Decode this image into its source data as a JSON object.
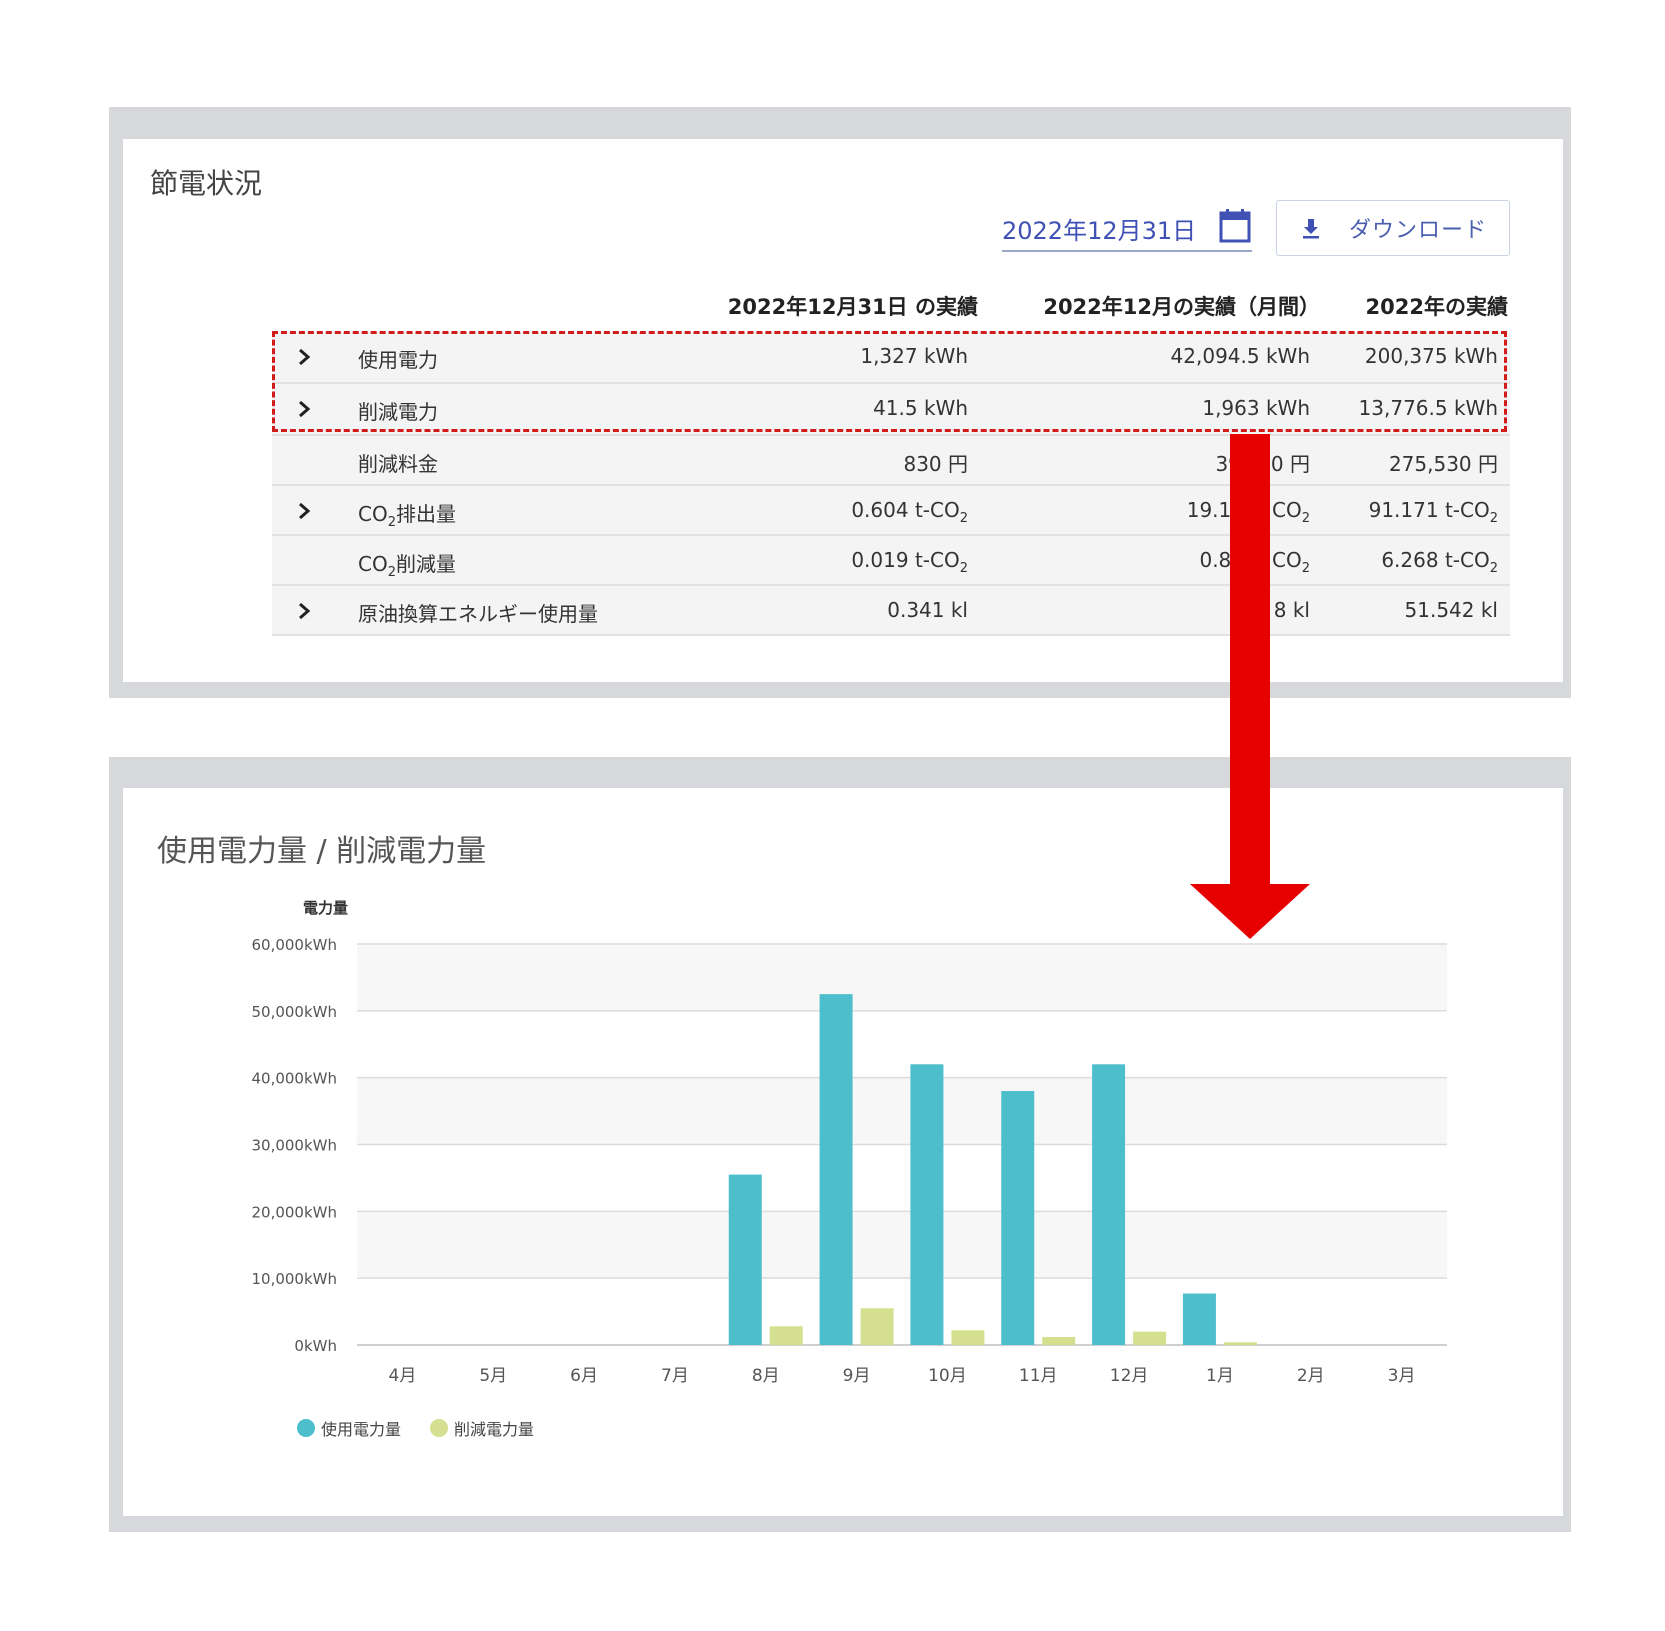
{
  "summary": {
    "title": "節電状況",
    "date_value": "2022年12月31日",
    "download_label": "ダウンロード",
    "columns": [
      "2022年12月31日 の実績",
      "2022年12月の実績（月間）",
      "2022年の実績"
    ],
    "rows": [
      {
        "expandable": true,
        "label": "使用電力",
        "day": "1,327 kWh",
        "month": "42,094.5 kWh",
        "year": "200,375 kWh"
      },
      {
        "expandable": true,
        "label": "削減電力",
        "day": "41.5 kWh",
        "month": "1,963 kWh",
        "year": "13,776.5 kWh"
      },
      {
        "expandable": false,
        "label": "削減料金",
        "day": "830 円",
        "month": "39",
        "month_tail": "0 円",
        "year": "275,530 円"
      },
      {
        "expandable": true,
        "label_pre": "CO",
        "label_sub": "2",
        "label_post": "排出量",
        "day": "0.604 t-CO",
        "day_sub": "2",
        "month": "19.15",
        "month_tail": "CO",
        "month_sub": "2",
        "year": "91.171 t-CO",
        "year_sub": "2"
      },
      {
        "expandable": false,
        "label_pre": "CO",
        "label_sub": "2",
        "label_post": "削減量",
        "day": "0.019 t-CO",
        "day_sub": "2",
        "month": "0.89",
        "month_tail": "CO",
        "month_sub": "2",
        "year": "6.268 t-CO",
        "year_sub": "2"
      },
      {
        "expandable": true,
        "label": "原油換算エネルギー使用量",
        "day": "0.341 kl",
        "month": "1",
        "month_tail": "8 kl",
        "year": "51.542 kl"
      }
    ]
  },
  "chart_panel": {
    "title": "使用電力量 / 削減電力量"
  },
  "chart_data": {
    "type": "bar",
    "ylabel": "電力量",
    "ylim": [
      0,
      60000
    ],
    "y_ticks": [
      "0kWh",
      "10,000kWh",
      "20,000kWh",
      "30,000kWh",
      "40,000kWh",
      "50,000kWh",
      "60,000kWh"
    ],
    "y_tick_values": [
      0,
      10000,
      20000,
      30000,
      40000,
      50000,
      60000
    ],
    "categories": [
      "4月",
      "5月",
      "6月",
      "7月",
      "8月",
      "9月",
      "10月",
      "11月",
      "12月",
      "1月",
      "2月",
      "3月"
    ],
    "series": [
      {
        "name": "使用電力量",
        "color": "#4dbfcc",
        "values": [
          0,
          0,
          0,
          0,
          25500,
          52500,
          42000,
          38000,
          42000,
          7700,
          0,
          0
        ]
      },
      {
        "name": "削減電力量",
        "color": "#d4e08f",
        "values": [
          0,
          0,
          0,
          0,
          2800,
          5500,
          2200,
          1200,
          2000,
          400,
          0,
          0
        ]
      }
    ],
    "grid": true,
    "legend_position": "bottom-left"
  },
  "colors": {
    "accent": "#3f51b5",
    "highlight": "#d11a1a",
    "arrow": "#e60000"
  }
}
